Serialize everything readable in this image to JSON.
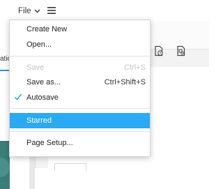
{
  "toolbar": {
    "file_label": "File",
    "chevron_icon": "chevron-down-icon",
    "menu_icon": "hamburger-menu-icon"
  },
  "left_panel": {
    "tab_label": "atio"
  },
  "canvas_toolbar": {
    "icons": [
      "clock-page-icon",
      "shapes-page-icon"
    ]
  },
  "file_menu": {
    "items": [
      {
        "label": "Create New",
        "shortcut": "",
        "state": "normal"
      },
      {
        "label": "Open...",
        "shortcut": "",
        "state": "normal"
      },
      {
        "label": "Save",
        "shortcut": "Ctrl+S",
        "state": "disabled"
      },
      {
        "label": "Save as...",
        "shortcut": "Ctrl+Shift+S",
        "state": "normal"
      },
      {
        "label": "Autosave",
        "shortcut": "",
        "state": "checked"
      },
      {
        "label": "Starred",
        "shortcut": "",
        "state": "highlighted"
      },
      {
        "label": "Page Setup...",
        "shortcut": "",
        "state": "normal"
      }
    ]
  },
  "colors": {
    "highlight": "#2aaaf2",
    "check": "#2aaaf2",
    "accent_tab": "#1f9ad6"
  }
}
